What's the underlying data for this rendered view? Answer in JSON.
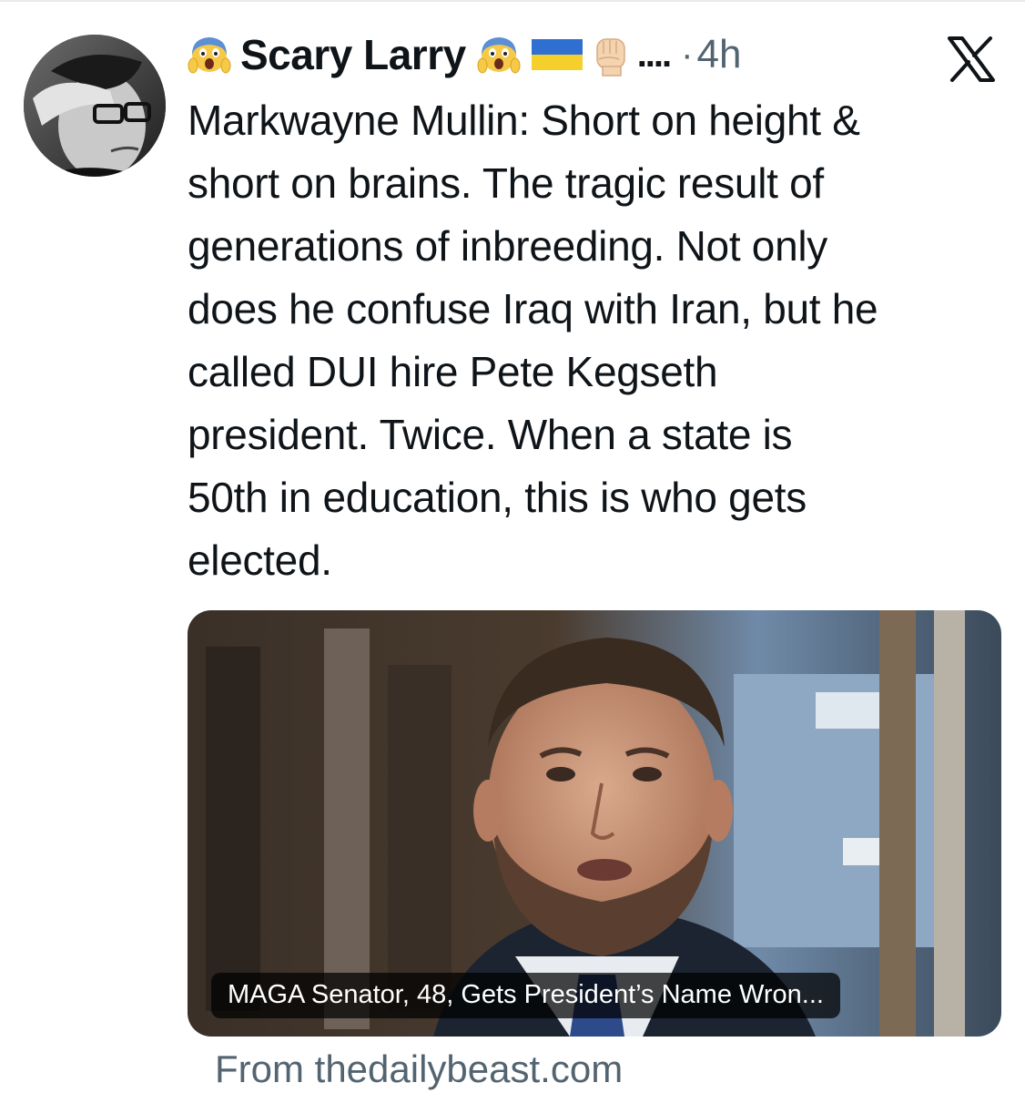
{
  "post": {
    "author": {
      "display_name": "Scary Larry",
      "name_decorations": [
        "scream-emoji",
        "scream-emoji",
        "ukraine-flag",
        "raised-fist"
      ],
      "truncation": "....",
      "separator": "·",
      "time_ago": "4h"
    },
    "close_icon": "x-logo-icon",
    "text": "Markwayne Mullin: Short on height &\nshort on brains. The tragic result of\ngenerations of inbreeding. Not only\ndoes he confuse Iraq with Iran, but he\ncalled DUI hire Pete Kegseth\npresident. Twice. When a state is\n50th in education, this is who gets\nelected.",
    "link_card": {
      "caption": "MAGA Senator, 48, Gets President’s Name Wron...",
      "source": "From thedailybeast.com"
    }
  },
  "colors": {
    "text_primary": "#0f1419",
    "text_secondary": "#536471",
    "divider": "#e7e9ea",
    "caption_bg": "#000000"
  }
}
